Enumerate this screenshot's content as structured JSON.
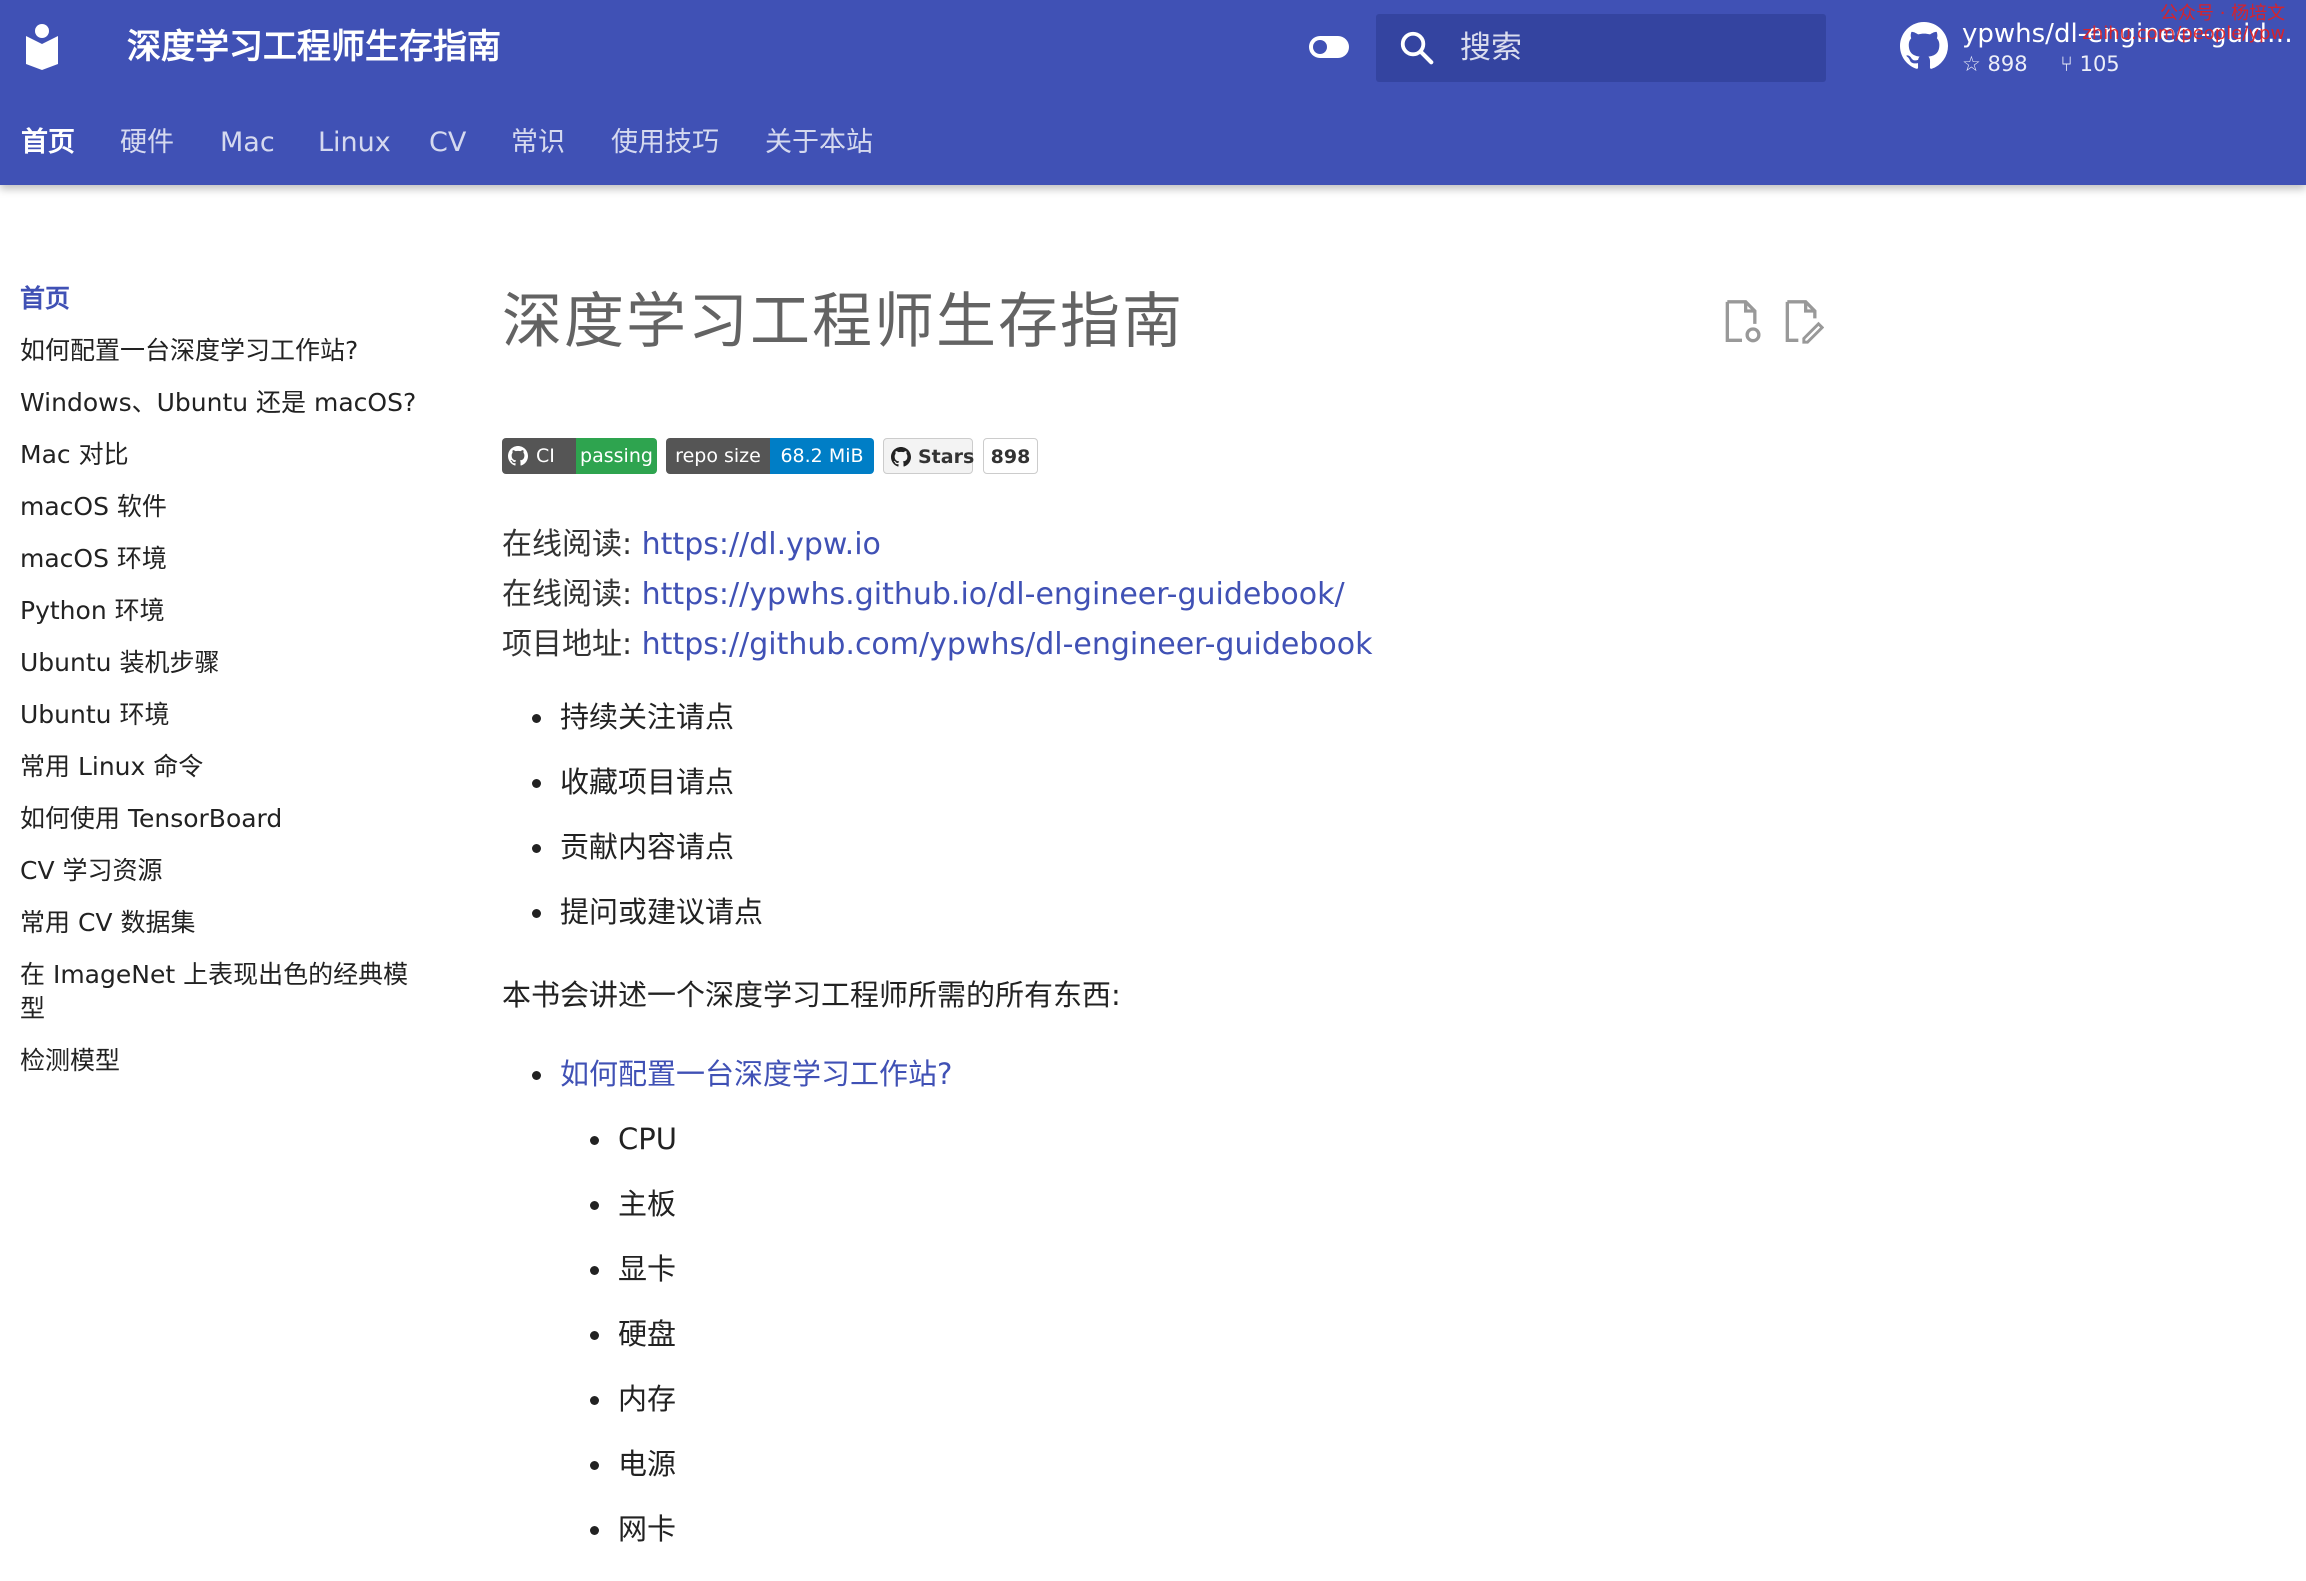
{
  "header": {
    "site_title": "深度学习工程师生存指南",
    "search_placeholder": "搜索",
    "repo_name": "ypwhs/dl-engineer-guidebo…",
    "repo_stars": "898",
    "repo_forks": "105",
    "watermark_line1": "公众号 · 杨培文",
    "watermark_line2": "zhihu.com/people/ypw"
  },
  "tabs": [
    {
      "label": "首页"
    },
    {
      "label": "硬件"
    },
    {
      "label": "Mac"
    },
    {
      "label": "Linux"
    },
    {
      "label": "CV"
    },
    {
      "label": "常识"
    },
    {
      "label": "使用技巧"
    },
    {
      "label": "关于本站"
    }
  ],
  "sidebar": {
    "items": [
      {
        "label": "首页"
      },
      {
        "label": "如何配置一台深度学习工作站?"
      },
      {
        "label": "Windows、Ubuntu 还是 macOS?"
      },
      {
        "label": "Mac 对比"
      },
      {
        "label": "macOS 软件"
      },
      {
        "label": "macOS 环境"
      },
      {
        "label": "Python 环境"
      },
      {
        "label": "Ubuntu 装机步骤"
      },
      {
        "label": "Ubuntu 环境"
      },
      {
        "label": "常用 Linux 命令"
      },
      {
        "label": "如何使用 TensorBoard"
      },
      {
        "label": "CV 学习资源"
      },
      {
        "label": "常用 CV 数据集"
      },
      {
        "label": "在 ImageNet 上表现出色的经典模型"
      },
      {
        "label": "检测模型"
      }
    ]
  },
  "content": {
    "title": "深度学习工程师生存指南",
    "badges": {
      "ci_label": "CI",
      "ci_status": "passing",
      "size_label": "repo size",
      "size_value": "68.2 MiB",
      "stars_label": "Stars",
      "stars_value": "898"
    },
    "links": [
      {
        "label": "在线阅读:",
        "url": "https://dl.ypw.io"
      },
      {
        "label": "在线阅读:",
        "url": "https://ypwhs.github.io/dl-engineer-guidebook/"
      },
      {
        "label": "项目地址:",
        "url": "https://github.com/ypwhs/dl-engineer-guidebook"
      }
    ],
    "bullets": [
      "持续关注请点",
      "收藏项目请点",
      "贡献内容请点",
      "提问或建议请点"
    ],
    "intro": "本书会讲述一个深度学习工程师所需的所有东西:",
    "toc_link": "如何配置一台深度学习工作站?",
    "toc_sub": [
      "CPU",
      "主板",
      "显卡",
      "硬盘",
      "内存",
      "电源",
      "网卡"
    ]
  },
  "colors": {
    "primary": "#4051b5",
    "link": "#4051b5",
    "badge_green": "#2ea44f",
    "badge_blue": "#007ec6",
    "badge_dark": "#555555"
  }
}
